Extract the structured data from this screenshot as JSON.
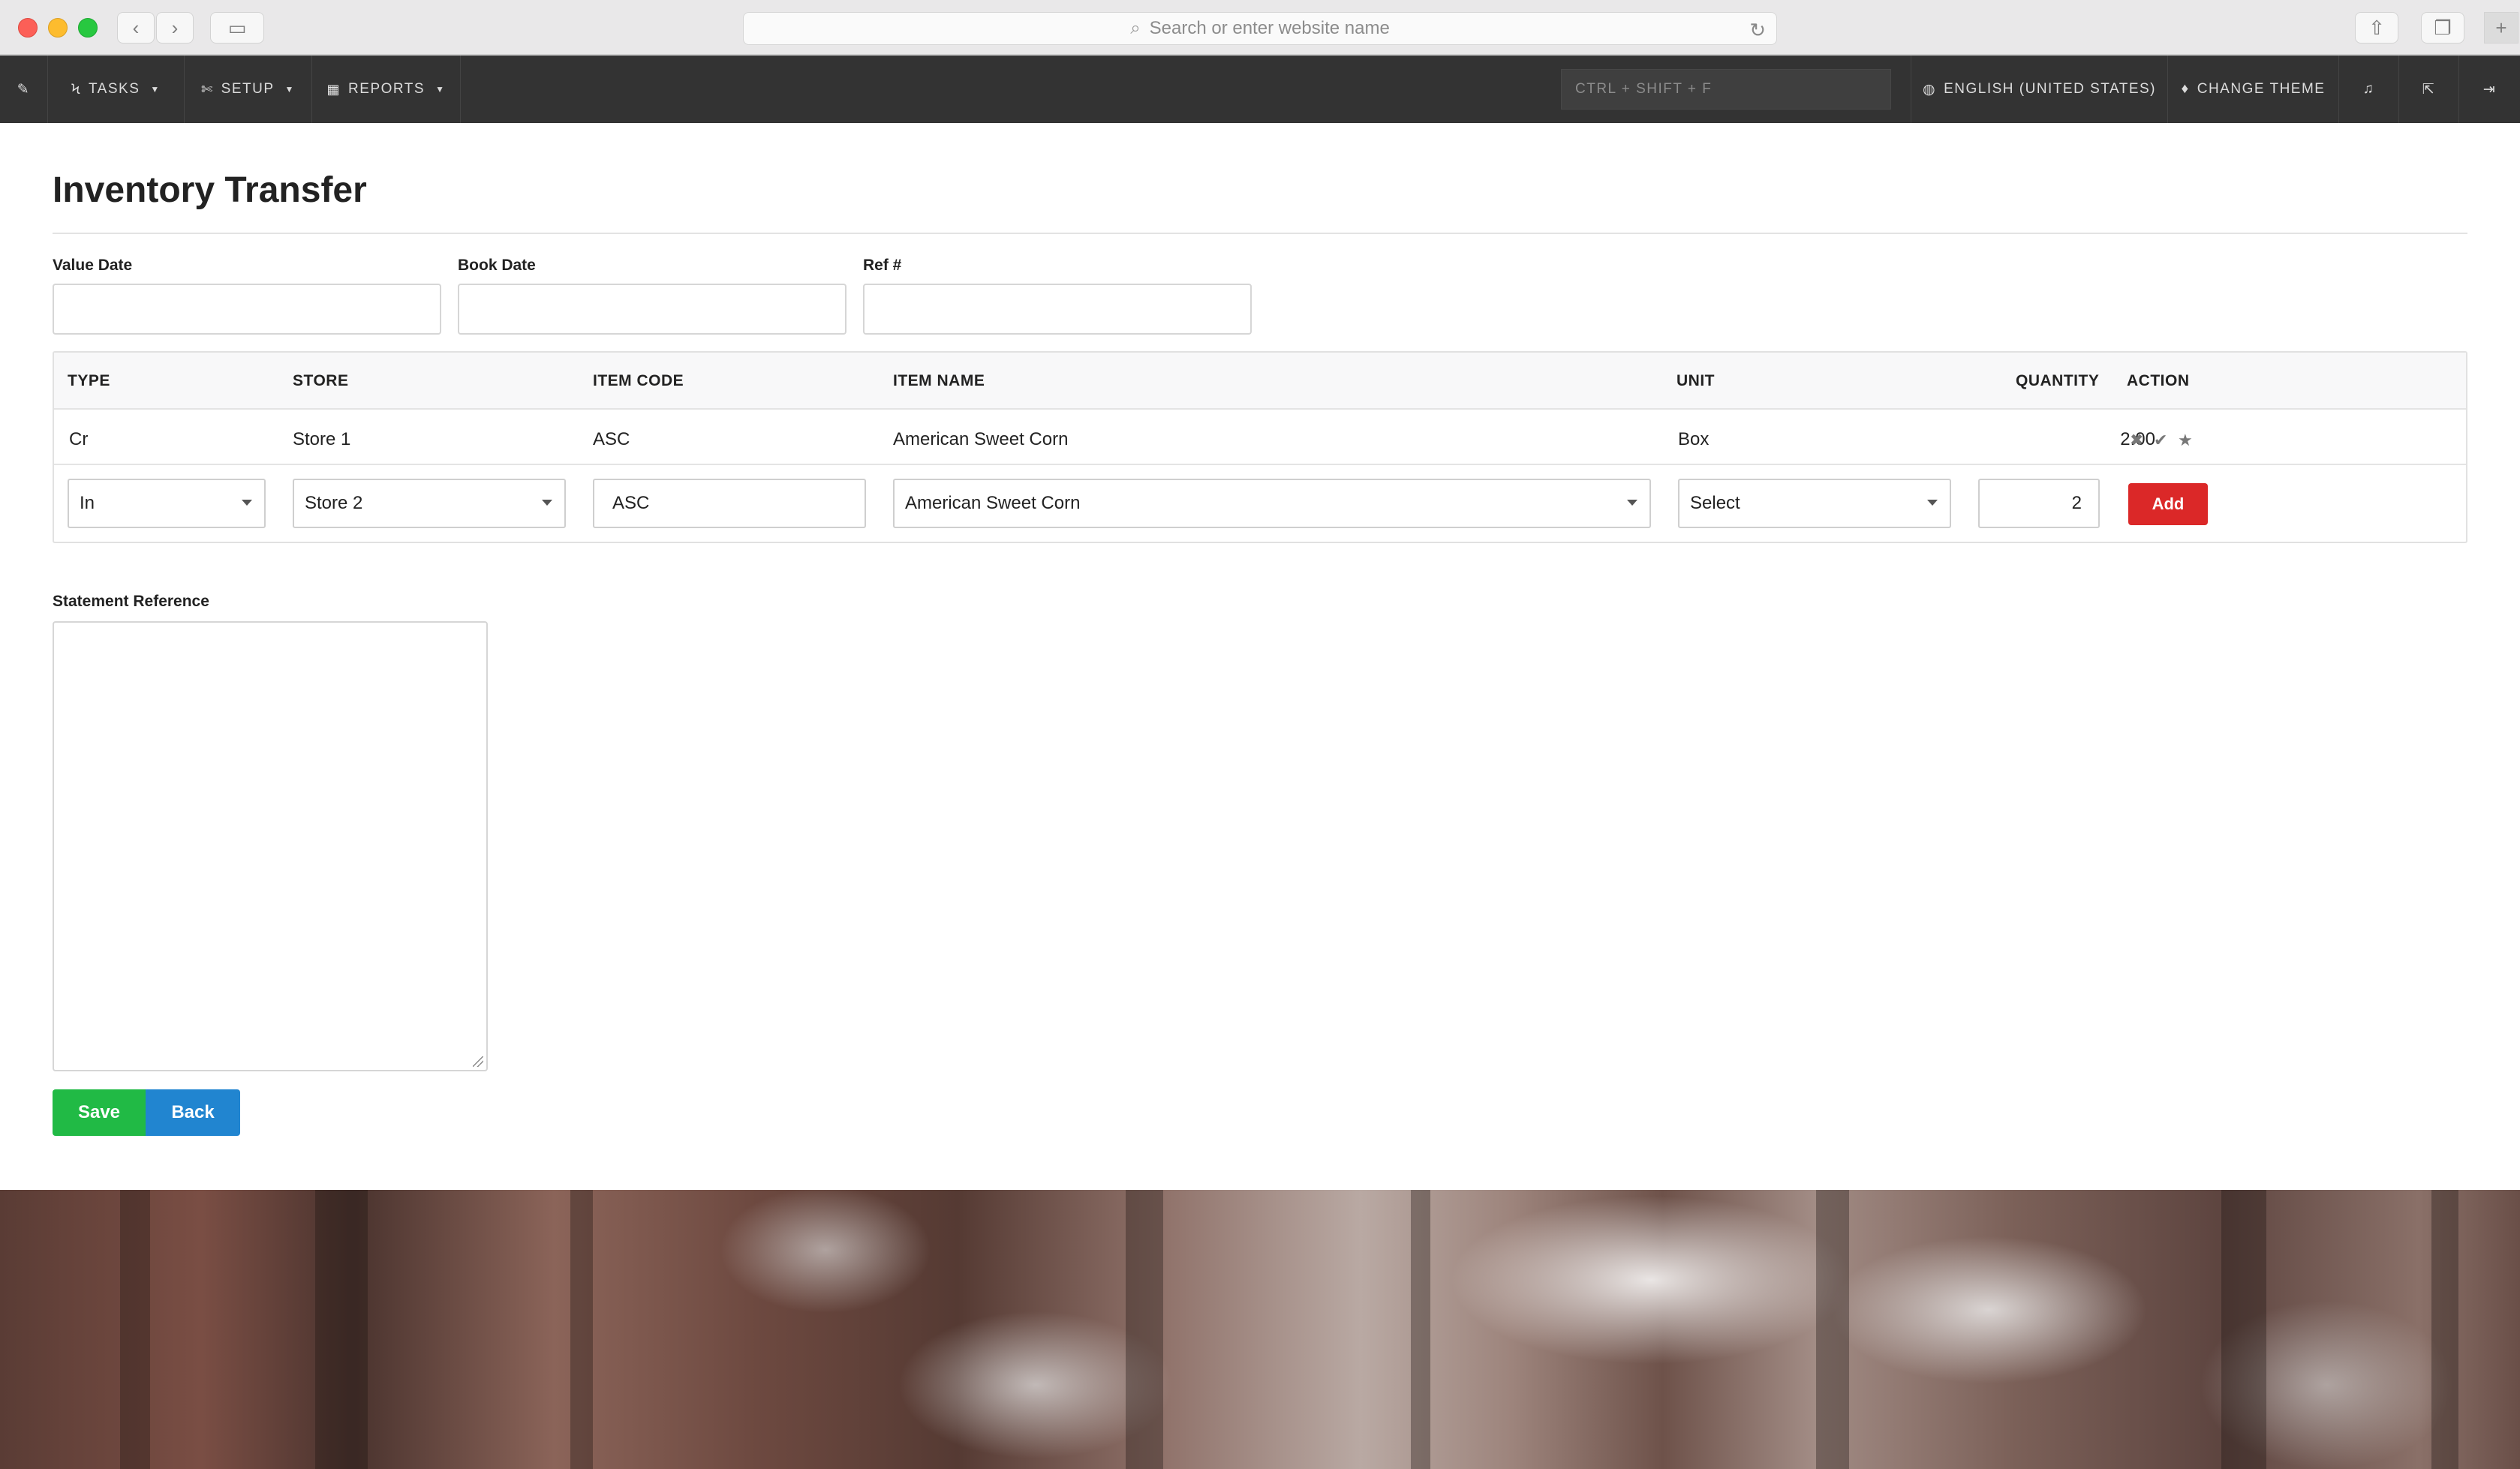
{
  "browser": {
    "search_placeholder": "Search or enter website name"
  },
  "nav": {
    "tasks": "TASKS",
    "setup": "SETUP",
    "reports": "REPORTS",
    "search_placeholder": "CTRL + SHIFT + F",
    "language": "ENGLISH (UNITED STATES)",
    "change_theme": "CHANGE THEME"
  },
  "page": {
    "title": "Inventory Transfer"
  },
  "form": {
    "value_date_label": "Value Date",
    "book_date_label": "Book Date",
    "ref_label": "Ref #",
    "statement_reference_label": "Statement Reference"
  },
  "grid": {
    "headers": [
      "TYPE",
      "STORE",
      "ITEM CODE",
      "ITEM NAME",
      "UNIT",
      "QUANTITY",
      "ACTION"
    ],
    "rows": [
      {
        "type": "Cr",
        "store": "Store 1",
        "item_code": "ASC",
        "item_name": "American Sweet Corn",
        "unit": "Box",
        "quantity": "2.00"
      }
    ],
    "entry": {
      "type": "In",
      "store": "Store 2",
      "item_code": "ASC",
      "item_name": "American Sweet Corn",
      "unit": "Select",
      "quantity": "2",
      "add_label": "Add"
    }
  },
  "buttons": {
    "save": "Save",
    "back": "Back"
  },
  "icons": {
    "pin": "pin-icon",
    "bolt": "bolt-icon",
    "wrench": "wrench-icon",
    "grid": "grid-icon",
    "globe": "globe-icon",
    "drop": "drop-icon",
    "bell": "bell-icon",
    "external": "external-link-icon",
    "signout": "sign-out-icon"
  },
  "colors": {
    "nav_bg": "#333333",
    "add_button": "#db2828",
    "save_button": "#21ba45",
    "back_button": "#2185d0"
  }
}
